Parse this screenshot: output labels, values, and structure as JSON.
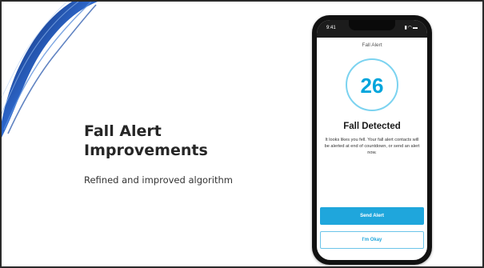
{
  "slide": {
    "title_line1": "Fall Alert",
    "title_line2": "Improvements",
    "subtitle": "Refined and improved algorithm"
  },
  "phone": {
    "status_time": "9:41",
    "app_title": "Fall Alert",
    "countdown": "26",
    "heading": "Fall Detected",
    "message": "It looks likes you fell. Your fall alert contacts will be alerted at end of countdown, or send an alert now.",
    "send_label": "Send Alert",
    "okay_label": "I'm Okay"
  },
  "colors": {
    "accent": "#1fa6dc",
    "ring": "#7cd3f0",
    "decor_dark": "#0b2a6a",
    "decor_light": "#6fa2e0"
  },
  "icons": [
    "signal-icon",
    "wifi-icon",
    "battery-icon"
  ]
}
